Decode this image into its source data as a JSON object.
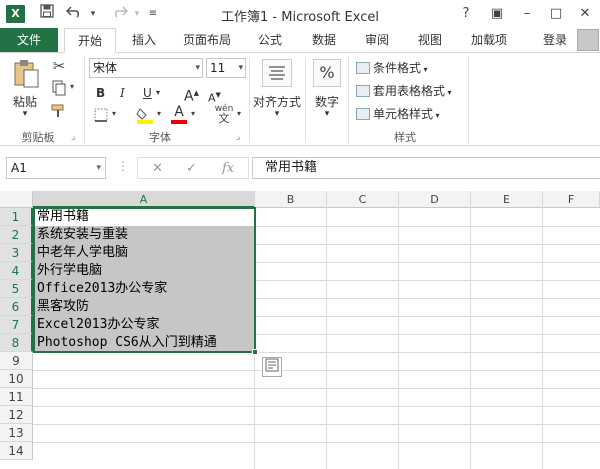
{
  "window": {
    "app_icon": "X",
    "title": "工作簿1 - Microsoft Excel",
    "controls": [
      "?",
      "▣",
      "–",
      "□",
      "✕"
    ]
  },
  "quick_access": {
    "save_icon": "save-icon",
    "undo_icon": "undo-icon",
    "redo_icon": "redo-icon",
    "customize_icon": "customize-icon"
  },
  "tabs": {
    "file": "文件",
    "items": [
      "开始",
      "插入",
      "页面布局",
      "公式",
      "数据",
      "审阅",
      "视图",
      "加载项"
    ],
    "active": "开始",
    "login": "登录"
  },
  "ribbon": {
    "clipboard": {
      "paste": "粘贴",
      "label": "剪贴板"
    },
    "font": {
      "name": "宋体",
      "size": "11",
      "bold": "B",
      "italic": "I",
      "underline": "U",
      "grow": "A",
      "shrink": "A",
      "wen": "wén",
      "wen_sub": "文",
      "label": "字体"
    },
    "alignment": {
      "label": "对齐方式"
    },
    "number": {
      "label": "数字",
      "symbol": "%"
    },
    "styles": {
      "conditional": "条件格式",
      "table": "套用表格格式",
      "cell": "单元格样式",
      "label": "样式"
    }
  },
  "formula_bar": {
    "cell_ref": "A1",
    "fx": "fx",
    "cancel": "✕",
    "enter": "✓",
    "content": "常用书籍"
  },
  "sheet": {
    "columns": [
      "A",
      "B",
      "C",
      "D",
      "E",
      "F"
    ],
    "selected_column": "A",
    "rows": [
      "1",
      "2",
      "3",
      "4",
      "5",
      "6",
      "7",
      "8",
      "9",
      "10",
      "11",
      "12",
      "13",
      "14"
    ],
    "cells": [
      "常用书籍",
      "系统安装与重装",
      "中老年人学电脑",
      "外行学电脑",
      "Office2013办公专家",
      "黑客攻防",
      "Excel2013办公专家",
      "Photoshop CS6从入门到精通"
    ],
    "selected_range": "A1:A8"
  },
  "colors": {
    "excel_green": "#217346",
    "selection_fill": "#c6c6c6"
  }
}
